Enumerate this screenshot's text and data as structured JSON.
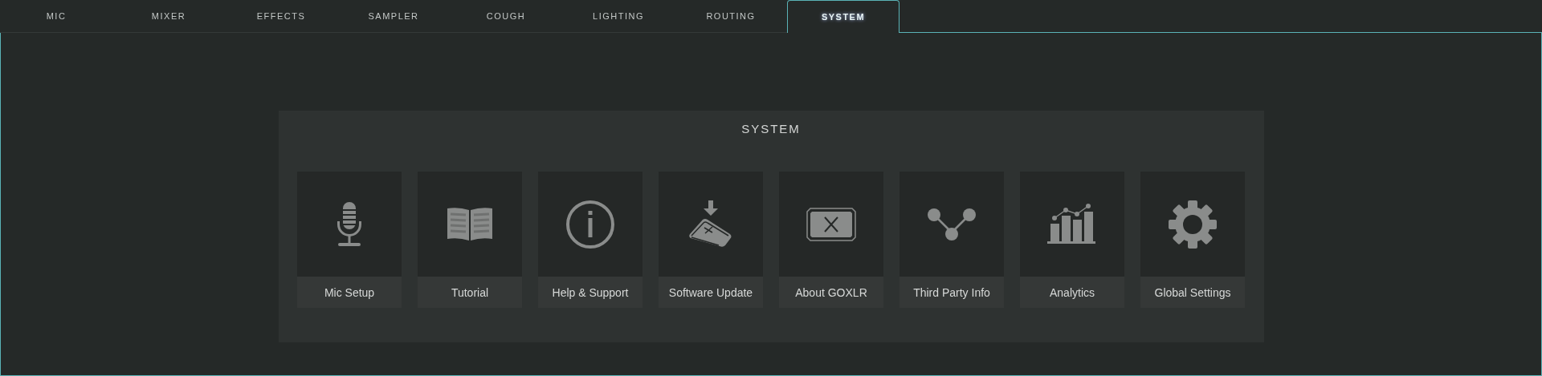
{
  "tabs": [
    {
      "label": "MIC",
      "selected": false
    },
    {
      "label": "MIXER",
      "selected": false
    },
    {
      "label": "EFFECTS",
      "selected": false
    },
    {
      "label": "SAMPLER",
      "selected": false
    },
    {
      "label": "COUGH",
      "selected": false
    },
    {
      "label": "LIGHTING",
      "selected": false
    },
    {
      "label": "ROUTING",
      "selected": false
    },
    {
      "label": "SYSTEM",
      "selected": true
    }
  ],
  "panel": {
    "title": "SYSTEM",
    "tiles": [
      {
        "label": "Mic Setup"
      },
      {
        "label": "Tutorial"
      },
      {
        "label": "Help & Support"
      },
      {
        "label": "Software Update"
      },
      {
        "label": "About GOXLR"
      },
      {
        "label": "Third Party Info"
      },
      {
        "label": "Analytics"
      },
      {
        "label": "Global Settings"
      }
    ]
  }
}
